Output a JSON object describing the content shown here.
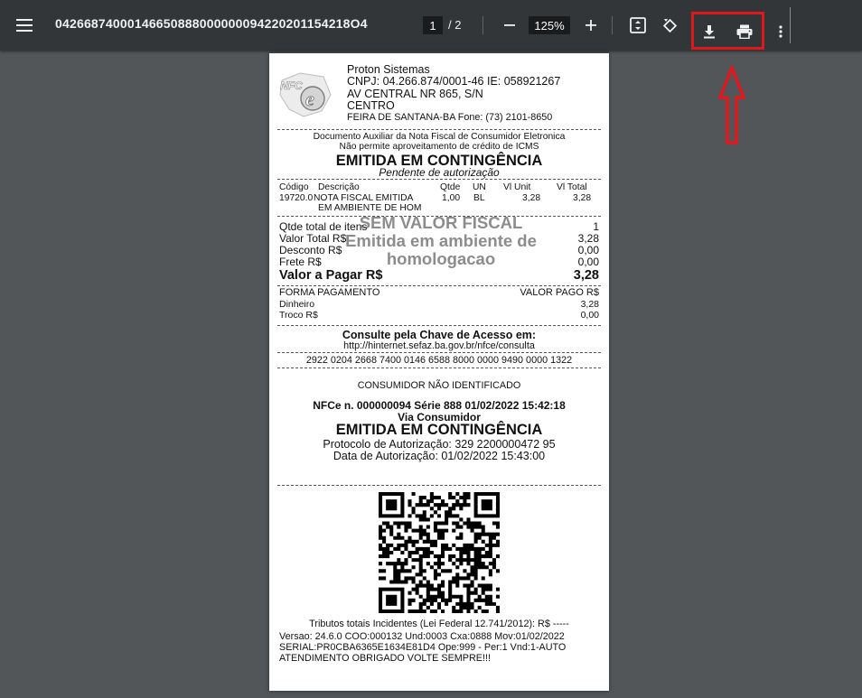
{
  "toolbar": {
    "menu_icon": "hamburger-menu-icon",
    "title": "04266874000146650888000000094220201154218O4",
    "page_current": "1",
    "page_total": "/ 2",
    "zoom": "125%",
    "icons": [
      "zoom-out-icon",
      "zoom-in-icon",
      "fit-page-icon",
      "rotate-icon",
      "download-icon",
      "print-icon",
      "more-vert-icon"
    ],
    "highlight_color": "#e0181d"
  },
  "receipt": {
    "logo_text": "NFC",
    "company": {
      "name": "Proton Sistemas",
      "cnpj": "CNPJ: 04.266.874/0001-46 IE: 058921267",
      "address": "AV CENTRAL NR 865, S/N",
      "district": "CENTRO",
      "city_phone": "FEIRA DE SANTANA-BA  Fone: (73) 2101-8650"
    },
    "doc_title1": "Documento Auxiliar da Nota Fiscal de Consumidor Eletronica",
    "doc_title2": "Não permite aproveitamento de crédito de ICMS",
    "contingency": "EMITIDA EM CONTINGÊNCIA",
    "pending": "Pendente de autorização",
    "items_header": {
      "code": "Código",
      "desc": "Descrição",
      "qty": "Qtde",
      "un": "UN",
      "unit": "Vl Unit",
      "total": "Vl Total"
    },
    "item": {
      "code": "19720.0",
      "desc": "NOTA FISCAL EMITIDA",
      "desc2": "EM AMBIENTE DE HOM",
      "qty": "1,00",
      "un": "BL",
      "unit": "3,28",
      "total": "3,28"
    },
    "watermark": [
      "SEM VALOR FISCAL",
      "Emitida em ambiente de",
      "homologacao"
    ],
    "totals": [
      {
        "label": "Qtde total de itens",
        "value": "1"
      },
      {
        "label": "Valor Total R$",
        "value": "3,28"
      },
      {
        "label": "Desconto R$",
        "value": "0,00"
      },
      {
        "label": "Frete R$",
        "value": "0,00"
      }
    ],
    "to_pay": {
      "label": "Valor a Pagar R$",
      "value": "3,28"
    },
    "payment_header": {
      "left": "FORMA PAGAMENTO",
      "right": "VALOR PAGO R$"
    },
    "payments": [
      {
        "label": "Dinheiro",
        "value": "3,28"
      },
      {
        "label": "Troco R$",
        "value": "0,00"
      }
    ],
    "consult_title": "Consulte pela Chave de Acesso em:",
    "consult_url": "http://hinternet.sefaz.ba.gov.br/nfce/consulta",
    "access_key": "2922 0204 2668 7400 0146 6588 8000 0000 9490 0000 1322",
    "consumer": "CONSUMIDOR NÃO IDENTIFICADO",
    "nfce_line": "NFCe n. 000000094 Série 888 01/02/2022 15:42:18",
    "via": "Via Consumidor",
    "contingency2": "EMITIDA EM CONTINGÊNCIA",
    "protocol": "Protocolo de Autorização:  329 2200000472 95",
    "auth_date": "Data de Autorização:  01/02/2022 15:43:00",
    "taxes": "Tributos totais Incidentes (Lei Federal 12.741/2012): R$ -----",
    "footer": [
      "Versao: 24.6.0 COO:000132 Und:0003 Cxa:0888 Mov:01/02/2022",
      "SERIAL:PR0CBA6365E1634E81D4 Ope:999 - Per:1 Vnd:1-AUTO",
      "ATENDIMENTO OBRIGADO VOLTE SEMPRE!!!"
    ]
  }
}
